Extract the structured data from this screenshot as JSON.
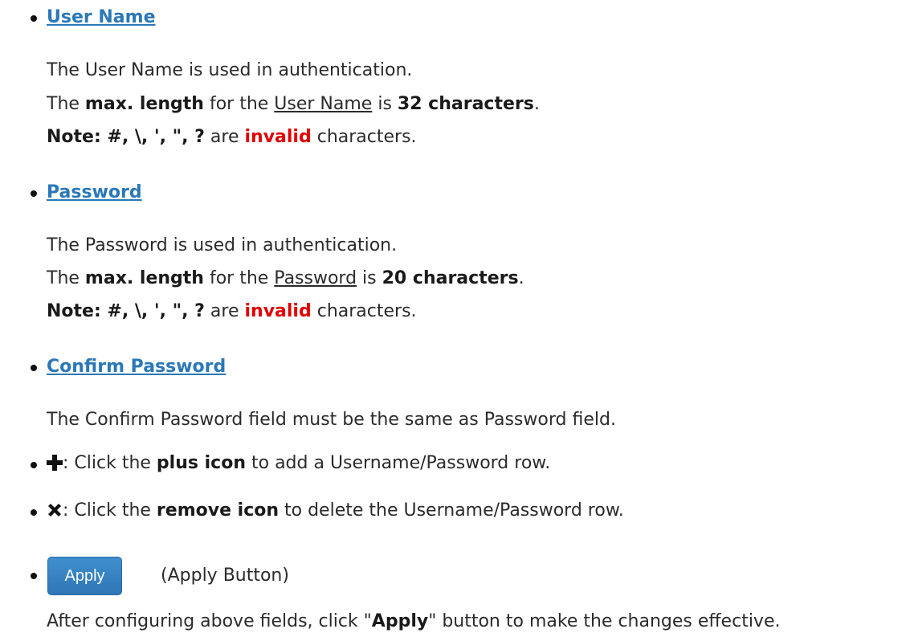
{
  "user_name": {
    "heading": "User Name",
    "line1": "The User Name is used in authentication.",
    "line2": {
      "pre": "The ",
      "bold1": "max. length",
      "mid1": " for the ",
      "link": "User Name",
      "mid2": " is ",
      "bold2": "32 characters",
      "post": "."
    },
    "note": {
      "bold": "Note: #, \\, ', \", ?",
      "mid": " are ",
      "red": "invalid",
      "post": " characters."
    }
  },
  "password": {
    "heading": "Password",
    "line1": "The Password is used in authentication.",
    "line2": {
      "pre": "The ",
      "bold1": "max. length",
      "mid1": " for the ",
      "link": "Password",
      "mid2": " is ",
      "bold2": "20 characters",
      "post": "."
    },
    "note": {
      "bold": "Note: #, \\, ', \", ?",
      "mid": " are ",
      "red": "invalid",
      "post": " characters."
    }
  },
  "confirm_password": {
    "heading": "Confirm Password",
    "line1": "The Confirm Password field must be the same as Password field."
  },
  "plus_item": {
    "icon": "plus-icon",
    "pre": ": Click the ",
    "bold": "plus icon",
    "post": " to add a Username/Password row."
  },
  "remove_item": {
    "icon": "remove-icon",
    "pre": ": Click the ",
    "bold": "remove icon",
    "post": " to delete the Username/Password row."
  },
  "apply_item": {
    "button_label": "Apply",
    "desc": "(Apply Button)",
    "line": {
      "pre": "After configuring above fields, click \"",
      "bold": "Apply",
      "post": "\" button to make the changes effective."
    }
  },
  "colors": {
    "heading": "#2a78b8",
    "invalid": "#e00000",
    "button": "#2f76b5"
  }
}
